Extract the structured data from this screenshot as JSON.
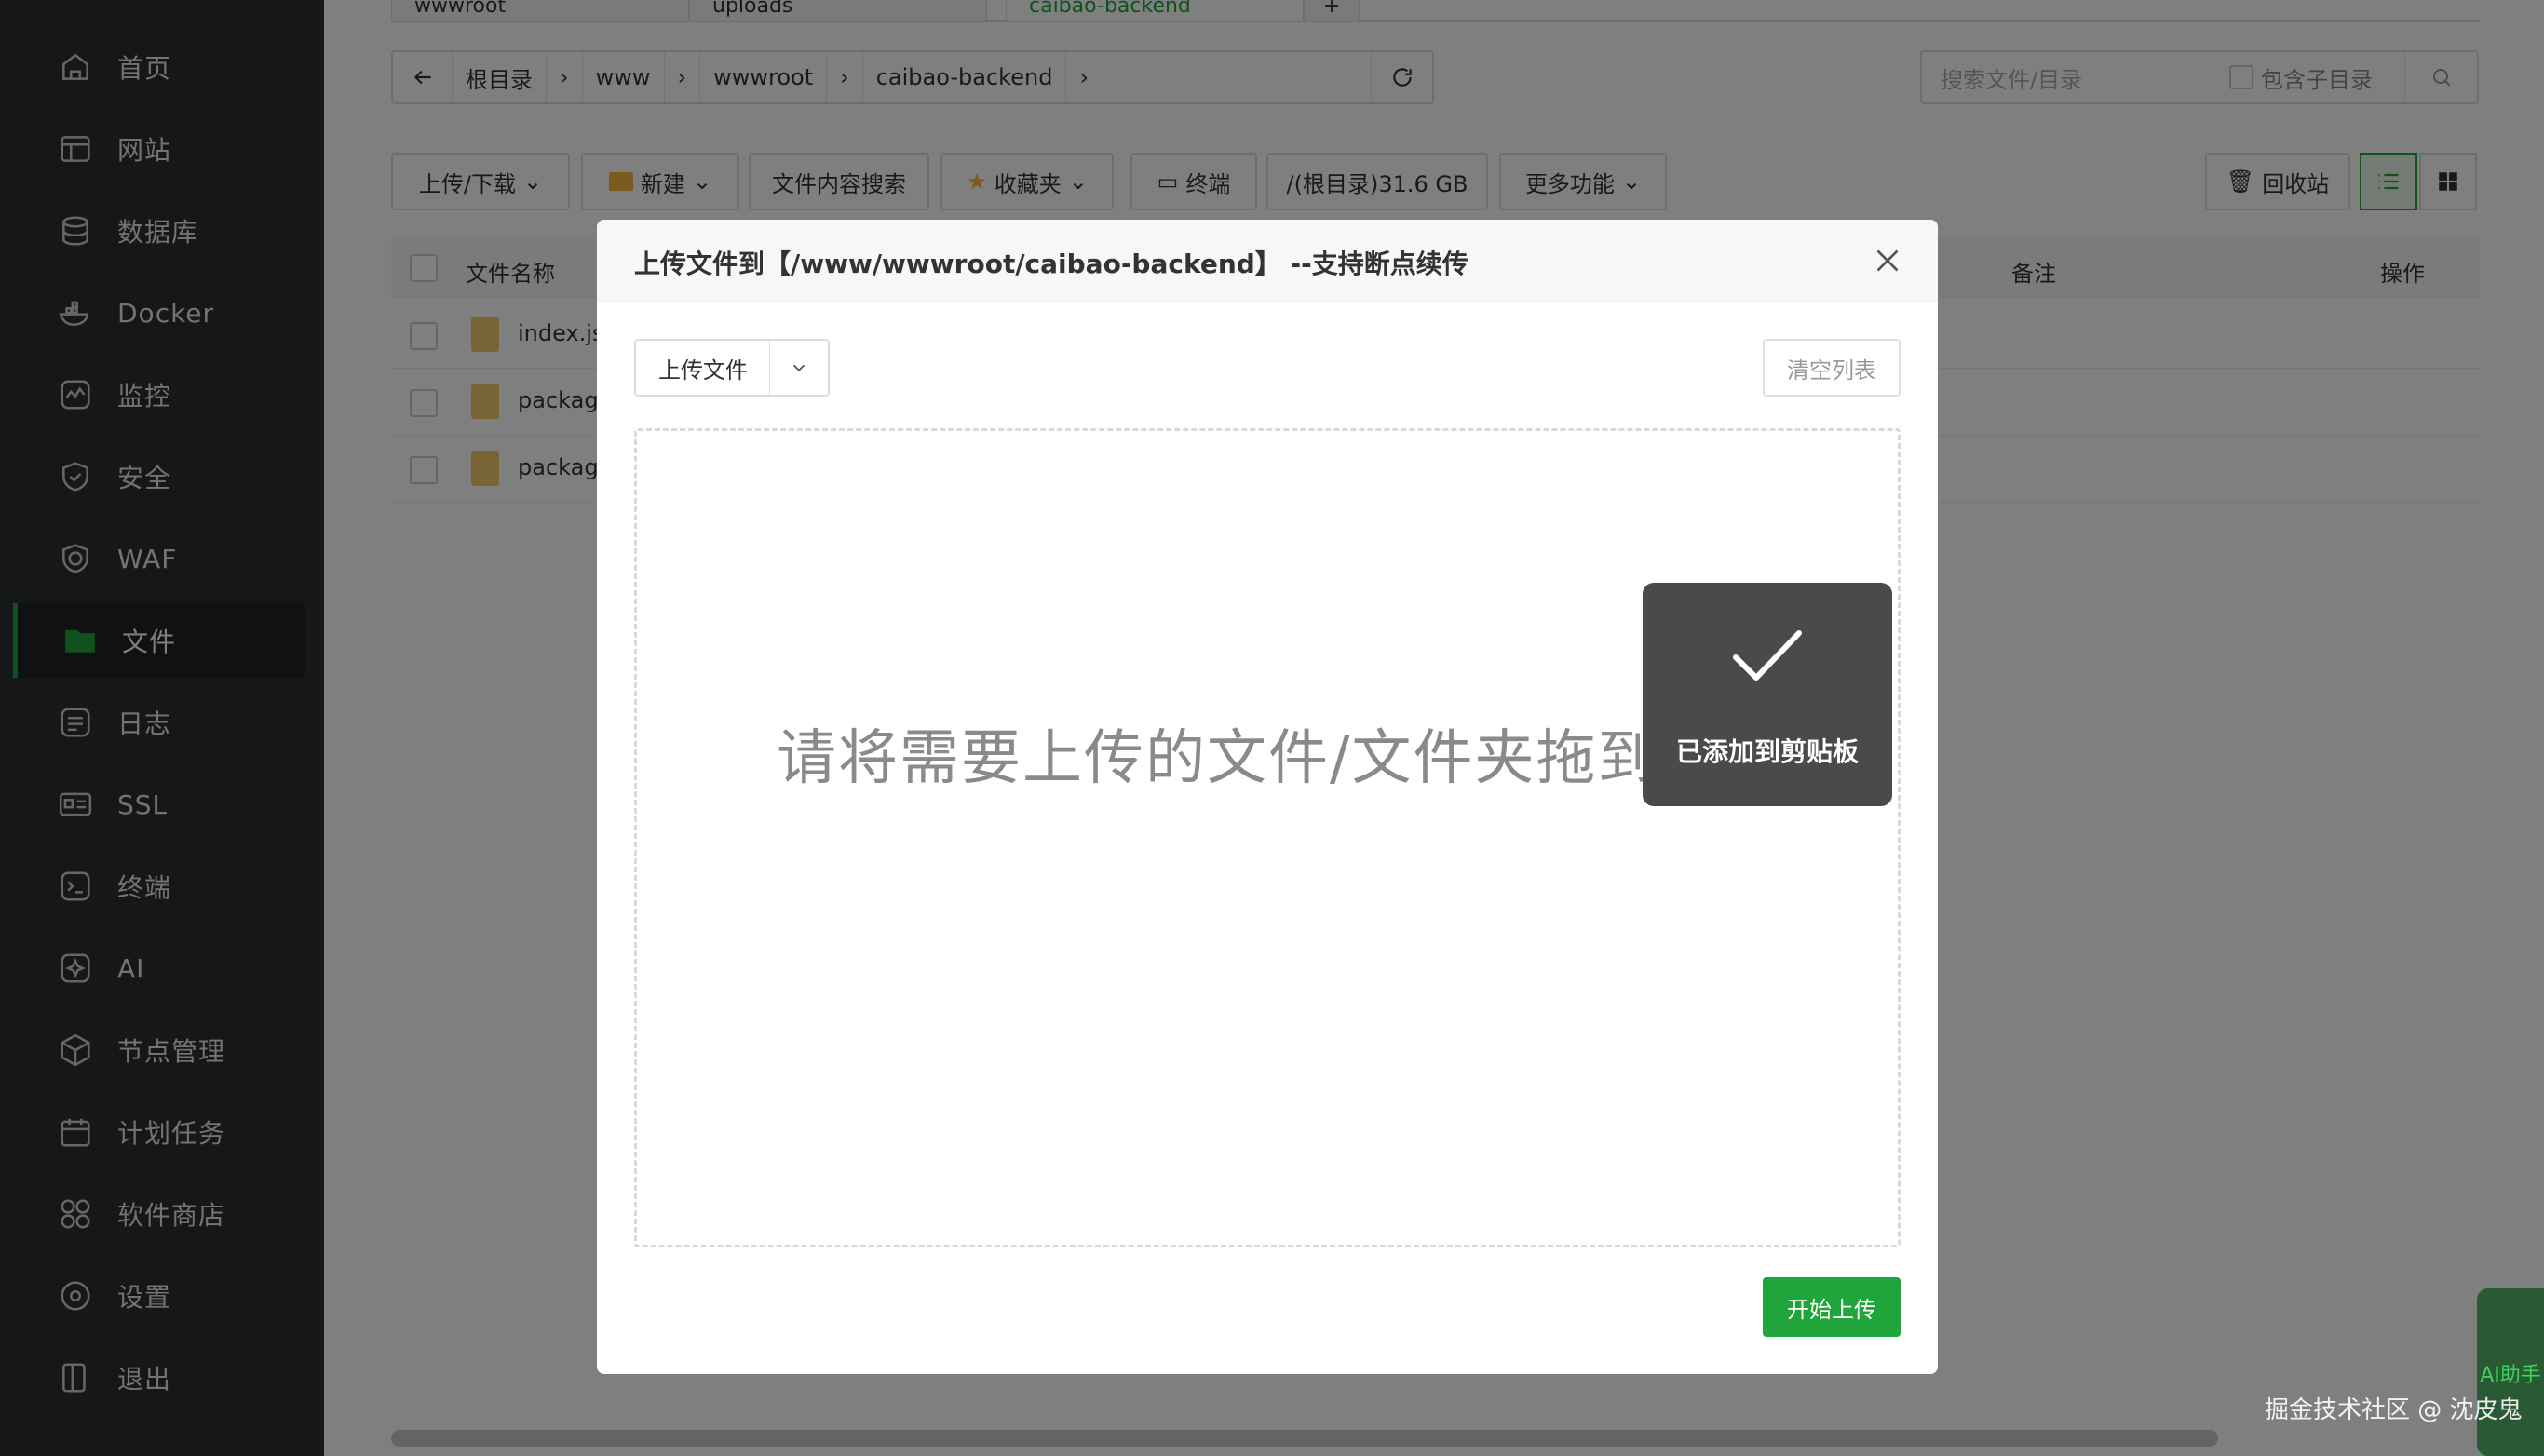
{
  "sidebar": {
    "items": [
      {
        "label": "首页",
        "icon": "home-icon"
      },
      {
        "label": "网站",
        "icon": "website-icon"
      },
      {
        "label": "数据库",
        "icon": "database-icon"
      },
      {
        "label": "Docker",
        "icon": "docker-icon"
      },
      {
        "label": "监控",
        "icon": "monitor-icon"
      },
      {
        "label": "安全",
        "icon": "shield-icon"
      },
      {
        "label": "WAF",
        "icon": "waf-icon"
      },
      {
        "label": "文件",
        "icon": "folder-icon",
        "active": true
      },
      {
        "label": "日志",
        "icon": "log-icon"
      },
      {
        "label": "SSL",
        "icon": "ssl-icon"
      },
      {
        "label": "终端",
        "icon": "terminal-icon"
      },
      {
        "label": "AI",
        "icon": "ai-icon"
      },
      {
        "label": "节点管理",
        "icon": "node-icon"
      },
      {
        "label": "计划任务",
        "icon": "calendar-icon"
      },
      {
        "label": "软件商店",
        "icon": "store-icon"
      },
      {
        "label": "设置",
        "icon": "gear-icon"
      },
      {
        "label": "退出",
        "icon": "logout-icon"
      }
    ]
  },
  "tabs": {
    "items": [
      {
        "label": "wwwroot"
      },
      {
        "label": "uploads"
      },
      {
        "label": "caibao-backend",
        "active": true
      }
    ],
    "add_label": "+"
  },
  "pathbar": {
    "segments": [
      "根目录",
      "www",
      "wwwroot",
      "caibao-backend"
    ]
  },
  "search": {
    "placeholder": "搜索文件/目录",
    "include_subdir_label": "包含子目录"
  },
  "toolbar": {
    "upload_download": "上传/下载",
    "new": "新建",
    "content_search": "文件内容搜索",
    "favorites": "收藏夹",
    "terminal": "终端",
    "disk": "/(根目录)31.6 GB",
    "more": "更多功能",
    "recycle_bin": "回收站"
  },
  "table": {
    "headers": {
      "name": "文件名称",
      "remark": "备注",
      "actions": "操作"
    },
    "rows": [
      {
        "name": "index.js"
      },
      {
        "name": "package"
      },
      {
        "name": "package"
      }
    ]
  },
  "modal": {
    "title": "上传文件到【/www/wwwroot/caibao-backend】 --支持断点续传",
    "upload_button": "上传文件",
    "clear_button": "清空列表",
    "drop_text": "请将需要上传的文件/文件夹拖到此处",
    "start_button": "开始上传"
  },
  "toast": {
    "message": "已添加到剪贴板"
  },
  "watermark": "掘金技术社区 @ 沈皮鬼",
  "ai_helper": {
    "label": "AI助手"
  },
  "colors": {
    "accent": "#20a53a",
    "sidebar_bg": "#2b2f33",
    "overlay": "rgba(0,0,0,0.5)"
  }
}
